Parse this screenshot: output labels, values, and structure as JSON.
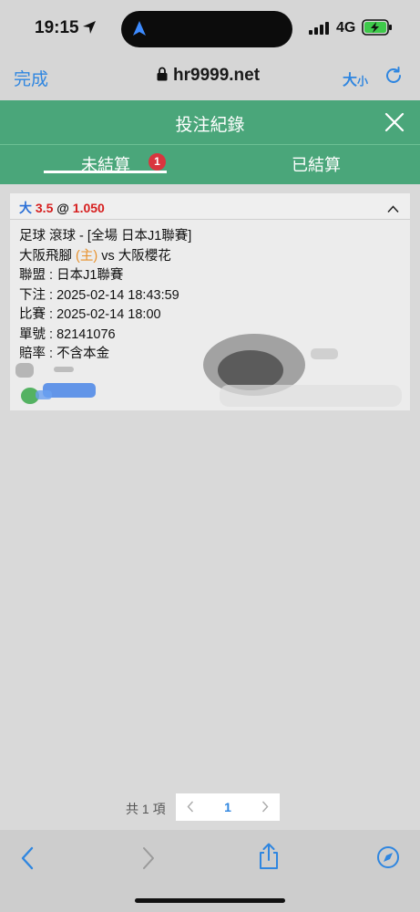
{
  "status_bar": {
    "time": "19:15",
    "network": "4G",
    "icons": [
      "location-arrow-icon",
      "navigation-icon",
      "signal-icon",
      "battery-charging-icon"
    ]
  },
  "browser": {
    "done_label": "完成",
    "url": "hr9999.net",
    "text_size_label_big": "大",
    "text_size_label_small": "小",
    "icons": [
      "lock-icon",
      "reload-icon"
    ]
  },
  "header": {
    "title": "投注紀錄",
    "close_icon": "close-icon",
    "background_color": "#4aa67a"
  },
  "tabs": [
    {
      "label": "未結算",
      "active": true,
      "badge": "1"
    },
    {
      "label": "已結算",
      "active": false
    }
  ],
  "bet": {
    "pick": "大",
    "line": "3.5",
    "at": "@",
    "odds": "1.050",
    "rows": {
      "sport": "足球 滾球 - [全場 日本J1聯賽]",
      "home_team": "大阪飛腳",
      "home_tag": "(主)",
      "vs": "vs",
      "away_team": "大阪櫻花",
      "league": "聯盟 : 日本J1聯賽",
      "placed": "下注 : 2025-02-14 18:43:59",
      "match_time": "比賽 : 2025-02-14 18:00",
      "ticket": "單號 : 82141076",
      "odds_type": "賠率 : 不含本金"
    },
    "colors": {
      "pick": "#2a6fd6",
      "odds": "#d61e1e",
      "home_tag": "#e8912b"
    }
  },
  "pagination": {
    "total_label": "共 1 項",
    "current_page": "1",
    "prev_icon": "chevron-left-icon",
    "next_icon": "chevron-right-icon"
  },
  "toolbar": {
    "icons": [
      "back-icon",
      "forward-icon",
      "share-icon",
      "compass-icon"
    ]
  }
}
